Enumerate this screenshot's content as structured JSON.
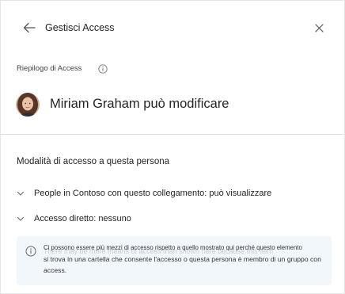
{
  "header": {
    "title": "Gestisci Access",
    "back_icon": "arrow-left-icon",
    "close_icon": "close-icon"
  },
  "summary": {
    "label": "Riepilogo di Access",
    "info_icon": "info-icon"
  },
  "person": {
    "name_line": "Miriam Graham può modificare"
  },
  "access": {
    "section_title": "Modalità di accesso a questa persona",
    "rows": [
      {
        "label": "People in Contoso con questo collegamento: può visualizzare",
        "icon": "chevron-down-icon"
      },
      {
        "label": "Accesso diretto: nessuno",
        "icon": "chevron-down-icon"
      }
    ]
  },
  "notice": {
    "icon": "info-icon",
    "line1": "Ci possono essere più mezzi di accesso rispetto a quello mostrato qui perché questo elemento",
    "line2": "si trova in una cartella che consente l'accesso o questa persona è membro di un gruppo con",
    "line3": "access.",
    "ghost_line": "There may be more means of access than shown here because this item"
  },
  "colors": {
    "accent": "#0f6cbd",
    "notice_bg": "#f2f7fc",
    "divider": "#e0e0e0"
  }
}
